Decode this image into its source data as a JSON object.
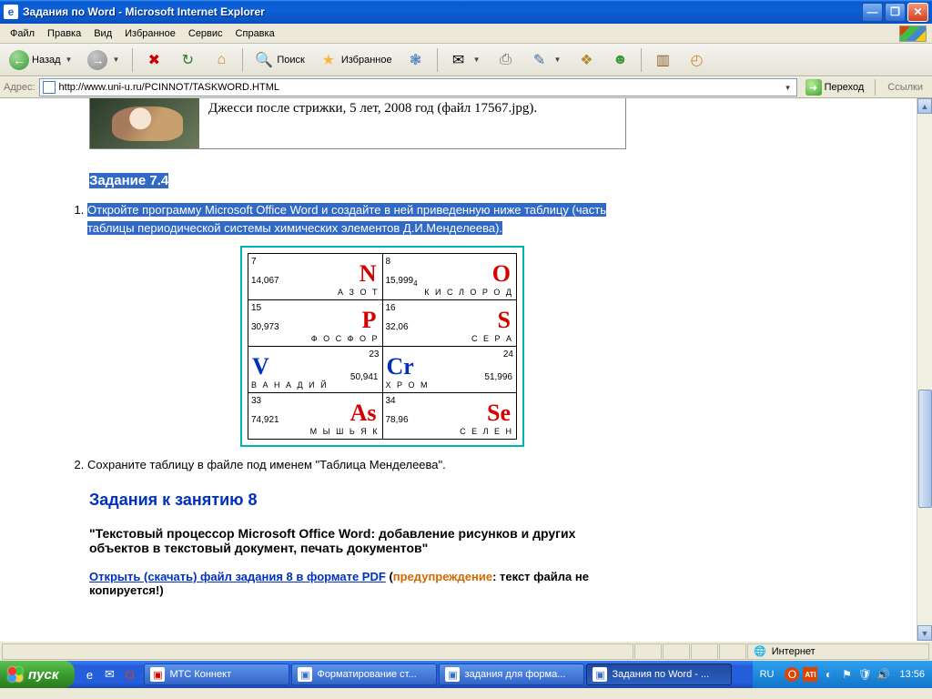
{
  "window": {
    "title": "Задания по Word - Microsoft Internet Explorer"
  },
  "menu": {
    "file": "Файл",
    "edit": "Правка",
    "view": "Вид",
    "favorites": "Избранное",
    "tools": "Сервис",
    "help": "Справка"
  },
  "toolbar": {
    "back": "Назад",
    "search": "Поиск",
    "favorites": "Избранное"
  },
  "address": {
    "label": "Адрес:",
    "url": "http://www.uni-u.ru/PCINNOT/TASKWORD.HTML",
    "go": "Переход",
    "links": "Ссылки"
  },
  "page": {
    "top_caption": "Джесси после стрижки, 5 лет, 2008 год (файл 17567.jpg).",
    "task74_title": "Задание 7.4",
    "task74_item1": "Откройте программу Microsoft Office Word и создайте в ней приведенную ниже таблицу (часть таблицы периодической системы химических элементов Д.И.Менделеева).",
    "task74_item2": "Сохраните таблицу в файле под именем \"Таблица Менделеева\".",
    "h8": "Задания к занятию 8",
    "desc8": "\"Текстовый процессор Microsoft Office Word: добавление рисунков и других объектов в текстовый документ, печать документов\"",
    "dl8_link": "Открыть (скачать) файл задания 8 в формате PDF",
    "dl8_warn_label": "предупреждение",
    "dl8_warn_text": ": текст файла не копируется!)",
    "periodic": [
      {
        "num": "7",
        "sym": "N",
        "mass": "14,067",
        "name": "А З О Т",
        "color": "red",
        "align": "right"
      },
      {
        "num": "8",
        "sym": "O",
        "mass": "15,999",
        "name": "К И С Л О Р О Д",
        "color": "red",
        "align": "right",
        "mass_suffix": "4"
      },
      {
        "num": "15",
        "sym": "P",
        "mass": "30,973",
        "name": "Ф О С Ф О Р",
        "color": "red",
        "align": "right"
      },
      {
        "num": "16",
        "sym": "S",
        "mass": "32,06",
        "name": "С Е Р А",
        "color": "red",
        "align": "right"
      },
      {
        "num": "23",
        "sym": "V",
        "mass": "50,941",
        "name": "В А Н А Д И Й",
        "color": "blue",
        "align": "left"
      },
      {
        "num": "24",
        "sym": "Cr",
        "mass": "51,996",
        "name": "Х Р О М",
        "color": "blue",
        "align": "left"
      },
      {
        "num": "33",
        "sym": "As",
        "mass": "74,921",
        "name": "М Ы Ш Ь Я К",
        "color": "red",
        "align": "right"
      },
      {
        "num": "34",
        "sym": "Se",
        "mass": "78,96",
        "name": "С Е Л Е Н",
        "color": "red",
        "align": "right"
      }
    ]
  },
  "status": {
    "zone": "Интернет"
  },
  "taskbar": {
    "start": "пуск",
    "tasks": [
      {
        "label": "МТС Коннект",
        "color": "#d40000"
      },
      {
        "label": "Форматирование ст...",
        "color": "#3a6fc8"
      },
      {
        "label": "задания для форма...",
        "color": "#3a6fc8"
      },
      {
        "label": "Задания по Word - ...",
        "color": "#3a6fc8",
        "active": true
      }
    ],
    "lang": "RU",
    "clock": "13:56"
  }
}
